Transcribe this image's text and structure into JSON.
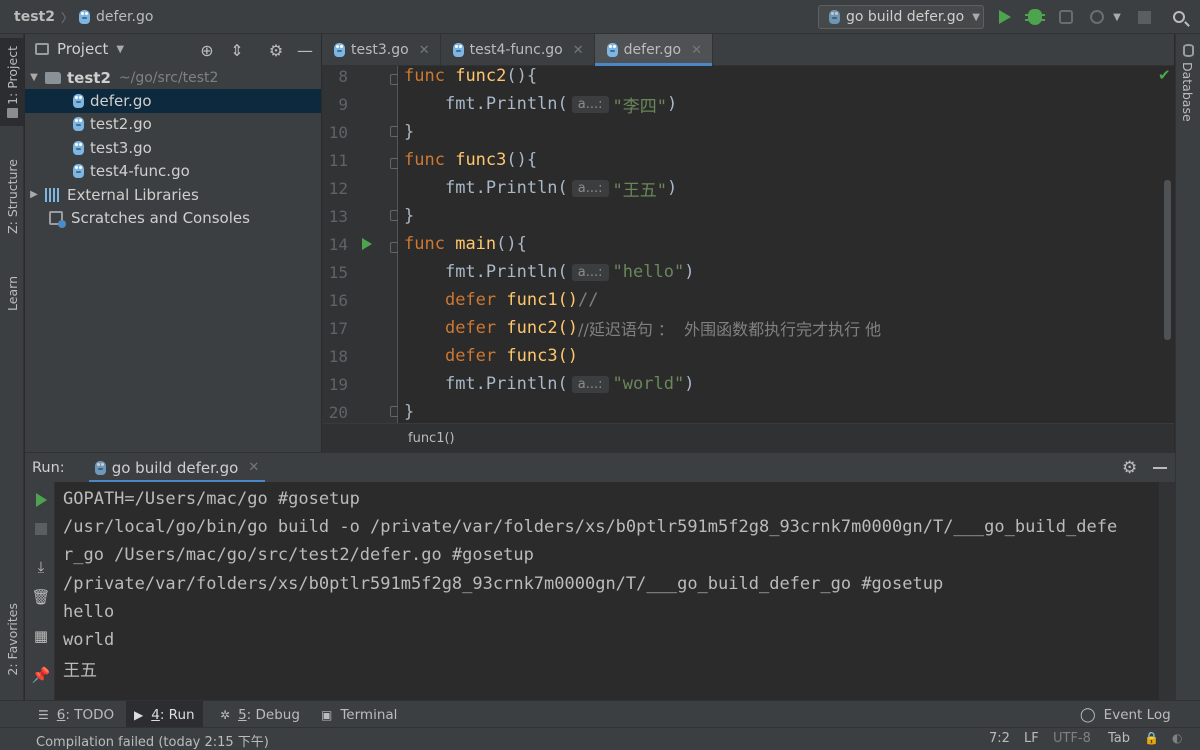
{
  "titlebar": {
    "project": "test2",
    "file": "defer.go",
    "run_config": "go build defer.go"
  },
  "side_tabs": {
    "project": "1: Project",
    "structure": "Z: Structure",
    "learn": "Learn",
    "favorites": "2: Favorites",
    "database": "Database"
  },
  "project_panel": {
    "title": "Project",
    "root": {
      "name": "test2",
      "path": "~/go/src/test2"
    },
    "files": [
      "defer.go",
      "test2.go",
      "test3.go",
      "test4-func.go"
    ],
    "external": "External Libraries",
    "scratches": "Scratches and Consoles"
  },
  "editor": {
    "tabs": [
      {
        "label": "test3.go",
        "active": false
      },
      {
        "label": "test4-func.go",
        "active": false
      },
      {
        "label": "defer.go",
        "active": true
      }
    ],
    "line_numbers": [
      "8",
      "9",
      "10",
      "11",
      "12",
      "13",
      "14",
      "15",
      "16",
      "17",
      "18",
      "19",
      "20"
    ],
    "hint": "a...:",
    "code": {
      "kw_func": "func",
      "kw_defer": "defer",
      "func2_decl": "func2",
      "func3_decl": "func3",
      "main_decl": "main",
      "parens_open": "(){",
      "close_brace": "}",
      "println": "fmt.Println(",
      "str_lisi": "\"李四\"",
      "str_wangwu": "\"王五\"",
      "str_hello": "\"hello\"",
      "str_world": "\"world\"",
      "close_paren": ")",
      "call_func1": "func1()",
      "call_func2": "func2()",
      "call_func3": "func3()",
      "comment_16": "//",
      "comment_17": "//延迟语句 ：  外围函数都执行完才执行 他"
    },
    "breadcrumb": "func1()"
  },
  "run_panel": {
    "label": "Run:",
    "tab": "go build defer.go",
    "output": [
      "GOPATH=/Users/mac/go #gosetup",
      "/usr/local/go/bin/go build -o /private/var/folders/xs/b0ptlr591m5f2g8_93crnk7m0000gn/T/___go_build_defe",
      "r_go /Users/mac/go/src/test2/defer.go #gosetup",
      "/private/var/folders/xs/b0ptlr591m5f2g8_93crnk7m0000gn/T/___go_build_defer_go #gosetup",
      "hello",
      "world",
      "王五"
    ]
  },
  "bottom_tabs": {
    "todo_key": "6",
    "todo": ": TODO",
    "run_key": "4",
    "run": ": Run",
    "debug_key": "5",
    "debug": ": Debug",
    "terminal": "Terminal",
    "event_log": "Event Log"
  },
  "status": {
    "message": "Compilation failed (today 2:15 下午)",
    "position": "7:2",
    "line_sep": "LF",
    "encoding": "UTF-8",
    "indent": "Tab"
  },
  "colors": {
    "keyword": "#cc7832",
    "function": "#ffc66d",
    "string": "#6a8759",
    "comment": "#808080",
    "run_green": "#4ea44e",
    "accent": "#4a88c7"
  }
}
